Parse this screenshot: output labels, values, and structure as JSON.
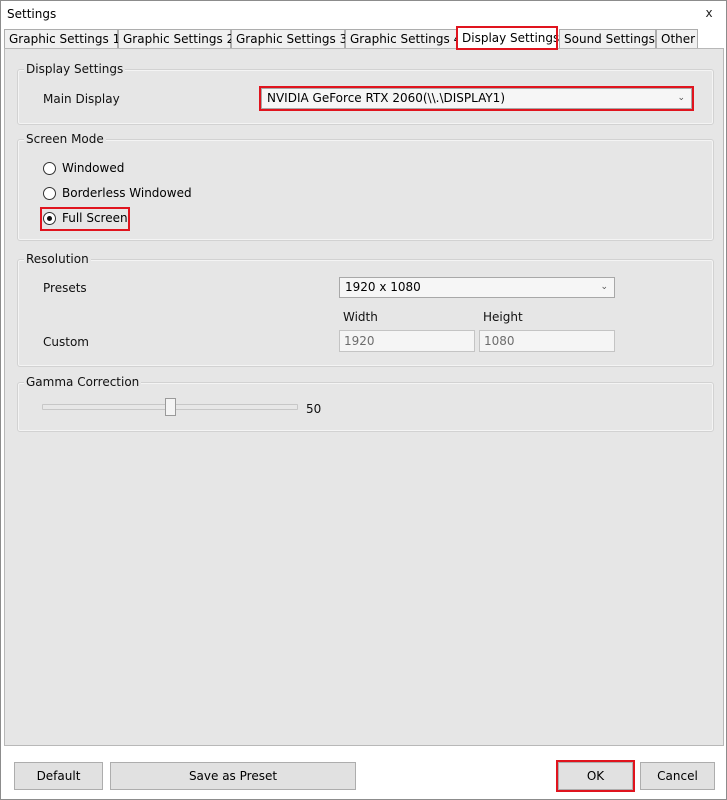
{
  "window": {
    "title": "Settings",
    "close_glyph": "x"
  },
  "tabs": [
    {
      "label": "Graphic Settings 1"
    },
    {
      "label": "Graphic Settings 2"
    },
    {
      "label": "Graphic Settings 3"
    },
    {
      "label": "Graphic Settings 4"
    },
    {
      "label": "Display Settings",
      "active": true
    },
    {
      "label": "Sound Settings"
    },
    {
      "label": "Other"
    }
  ],
  "display_settings": {
    "group_label": "Display Settings",
    "main_display_label": "Main Display",
    "main_display_value": "NVIDIA GeForce RTX 2060(\\\\.\\DISPLAY1)"
  },
  "screen_mode": {
    "group_label": "Screen Mode",
    "options": [
      {
        "label": "Windowed",
        "selected": false
      },
      {
        "label": "Borderless Windowed",
        "selected": false
      },
      {
        "label": "Full Screen",
        "selected": true
      }
    ]
  },
  "resolution": {
    "group_label": "Resolution",
    "presets_label": "Presets",
    "presets_value": "1920 x 1080",
    "custom_label": "Custom",
    "width_label": "Width",
    "height_label": "Height",
    "width_value": "1920",
    "height_value": "1080"
  },
  "gamma": {
    "group_label": "Gamma Correction",
    "value_text": "50",
    "value": 50,
    "min": 0,
    "max": 100
  },
  "buttons": {
    "default": "Default",
    "save_preset": "Save as Preset",
    "ok": "OK",
    "cancel": "Cancel"
  },
  "colors": {
    "highlight": "#e0141e",
    "panel_bg": "#e6e6e6"
  }
}
